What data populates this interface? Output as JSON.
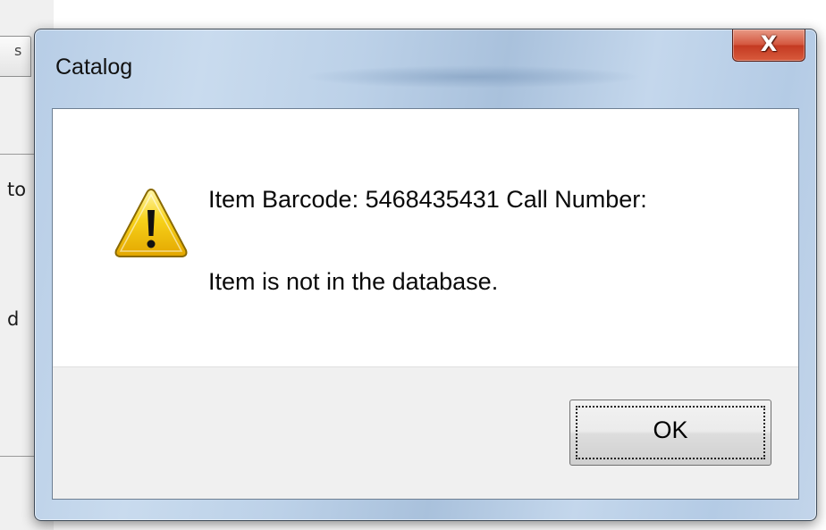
{
  "background_window": {
    "tab_fragment": "s",
    "text_fragment_1": "to",
    "text_fragment_2": "d"
  },
  "dialog": {
    "title": "Catalog",
    "close_glyph": "X",
    "message_line_1": "Item Barcode: 5468435431 Call Number:",
    "message_line_2": "Item is not in the database.",
    "icon": "warning-icon",
    "ok_label": "OK"
  },
  "colors": {
    "title_bar": "#bcd1e8",
    "close_button": "#c43a22",
    "warning_icon": "#f2c200"
  }
}
